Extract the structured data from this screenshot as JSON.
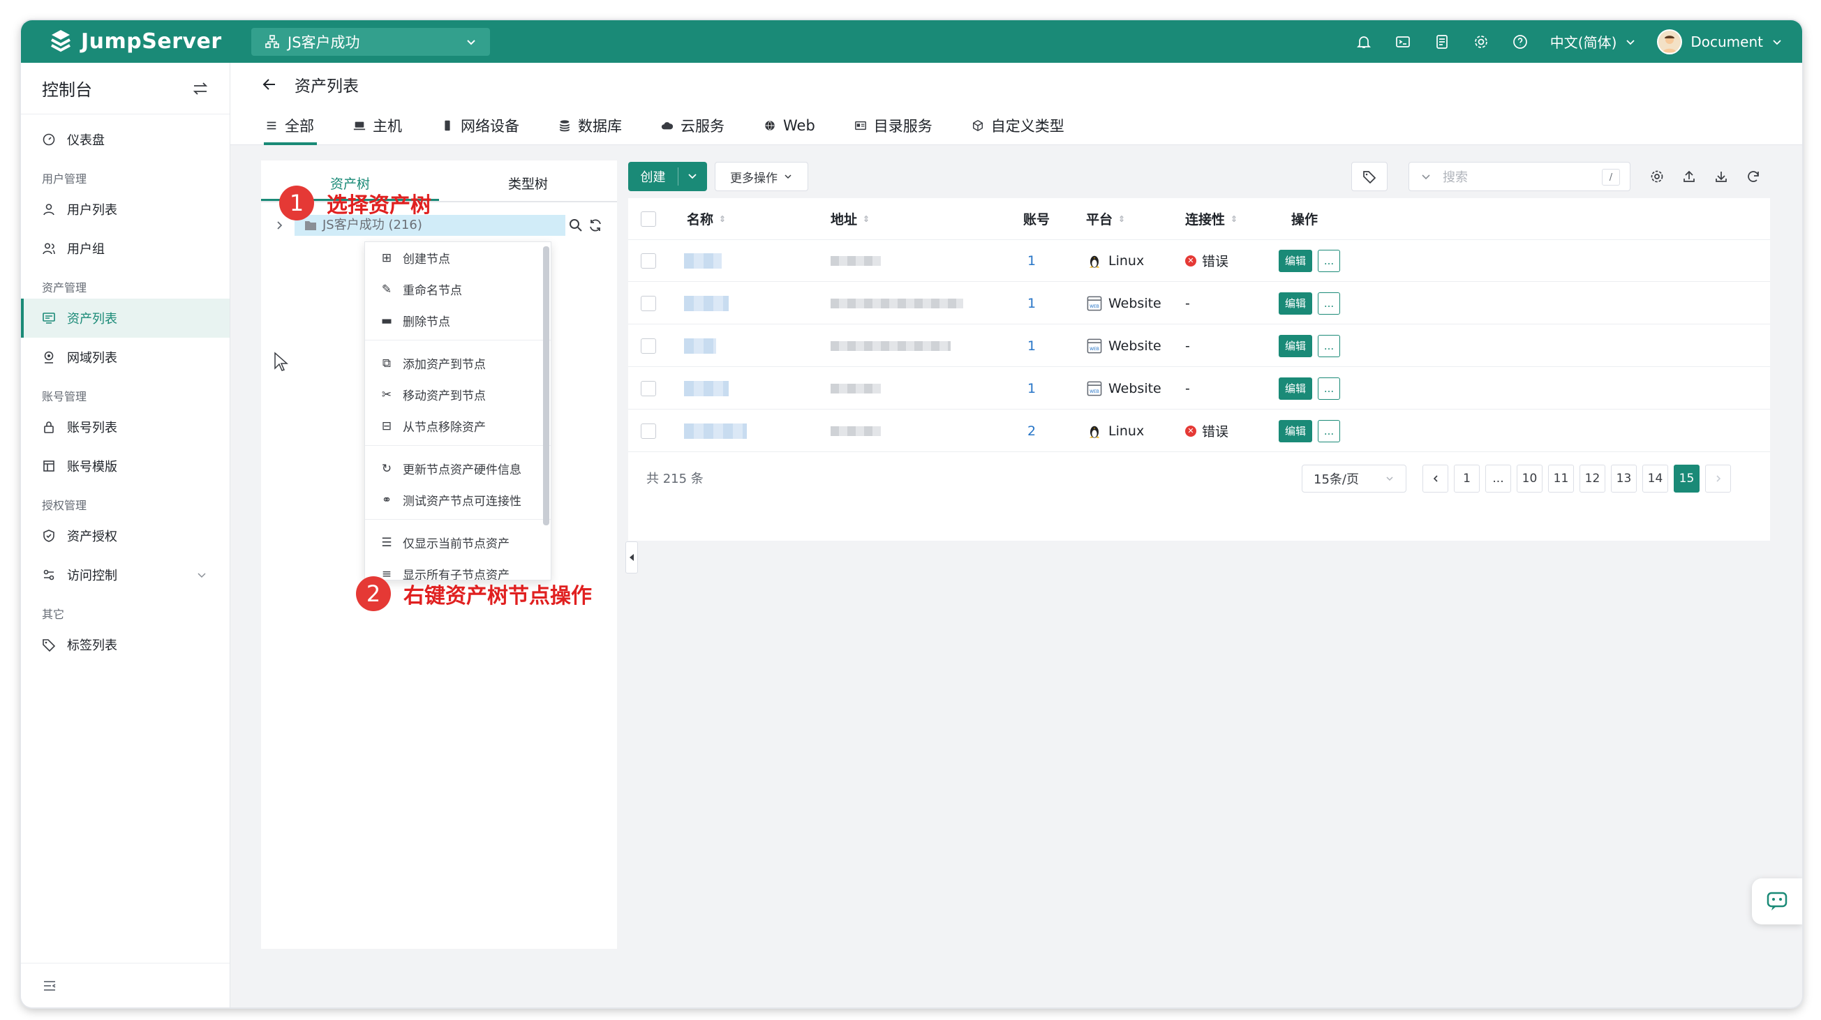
{
  "topbar": {
    "brand": "JumpServer",
    "org_name": "JS客户成功",
    "language": "中文(简体)",
    "username": "Document",
    "bg_color": "#1a8a77"
  },
  "sidebar": {
    "title": "控制台",
    "items": [
      {
        "type": "item",
        "label": "仪表盘",
        "icon": "dashboard-icon"
      },
      {
        "type": "group",
        "label": "用户管理"
      },
      {
        "type": "item",
        "label": "用户列表",
        "icon": "user-icon"
      },
      {
        "type": "item",
        "label": "用户组",
        "icon": "user-group-icon"
      },
      {
        "type": "group",
        "label": "资产管理"
      },
      {
        "type": "item",
        "label": "资产列表",
        "icon": "asset-icon",
        "active": true
      },
      {
        "type": "item",
        "label": "网域列表",
        "icon": "domain-icon"
      },
      {
        "type": "group",
        "label": "账号管理"
      },
      {
        "type": "item",
        "label": "账号列表",
        "icon": "lock-icon"
      },
      {
        "type": "item",
        "label": "账号模版",
        "icon": "template-icon"
      },
      {
        "type": "group",
        "label": "授权管理"
      },
      {
        "type": "item",
        "label": "资产授权",
        "icon": "shield-icon"
      },
      {
        "type": "item",
        "label": "访问控制",
        "icon": "acl-icon",
        "expandable": true
      },
      {
        "type": "group",
        "label": "其它"
      },
      {
        "type": "item",
        "label": "标签列表",
        "icon": "tag-icon"
      }
    ]
  },
  "page": {
    "title": "资产列表",
    "tabs": [
      {
        "label": "全部",
        "icon": "list-icon",
        "active": true
      },
      {
        "label": "主机",
        "icon": "host-icon"
      },
      {
        "label": "网络设备",
        "icon": "network-device-icon"
      },
      {
        "label": "数据库",
        "icon": "database-icon"
      },
      {
        "label": "云服务",
        "icon": "cloud-icon"
      },
      {
        "label": "Web",
        "icon": "globe-icon"
      },
      {
        "label": "目录服务",
        "icon": "directory-icon"
      },
      {
        "label": "自定义类型",
        "icon": "cube-icon"
      }
    ]
  },
  "tree": {
    "tabs": [
      "资产树",
      "类型树"
    ],
    "root_label": "JS客户成功 (216)",
    "context_menu": [
      [
        "创建节点",
        "重命名节点",
        "删除节点"
      ],
      [
        "添加资产到节点",
        "移动资产到节点",
        "从节点移除资产"
      ],
      [
        "更新节点资产硬件信息",
        "测试资产节点可连接性"
      ],
      [
        "仅显示当前节点资产",
        "显示所有子节点资产"
      ]
    ]
  },
  "annotations": {
    "step1_number": "1",
    "step1_text": "选择资产树",
    "step2_number": "2",
    "step2_text": "右键资产树节点操作"
  },
  "toolbar": {
    "create_label": "创建",
    "more_label": "更多操作",
    "search_placeholder": "搜索",
    "search_shortcut": "/"
  },
  "table": {
    "headers": {
      "name": "名称",
      "address": "地址",
      "accounts": "账号",
      "platform": "平台",
      "connectivity": "连接性",
      "actions": "操作"
    },
    "edit_label": "编辑",
    "more_label": "...",
    "rows": [
      {
        "accounts": "1",
        "platform": "Linux",
        "platform_icon": "linux-icon",
        "connectivity": "错误"
      },
      {
        "accounts": "1",
        "platform": "Website",
        "platform_icon": "web-icon",
        "connectivity": "-"
      },
      {
        "accounts": "1",
        "platform": "Website",
        "platform_icon": "web-icon",
        "connectivity": "-"
      },
      {
        "accounts": "1",
        "platform": "Website",
        "platform_icon": "web-icon",
        "connectivity": "-"
      },
      {
        "accounts": "2",
        "platform": "Linux",
        "platform_icon": "linux-icon",
        "connectivity": "错误"
      }
    ]
  },
  "pagination": {
    "total": "共 215 条",
    "page_size": "15条/页",
    "pages": [
      "1",
      "...",
      "10",
      "11",
      "12",
      "13",
      "14",
      "15"
    ],
    "current": "15"
  }
}
